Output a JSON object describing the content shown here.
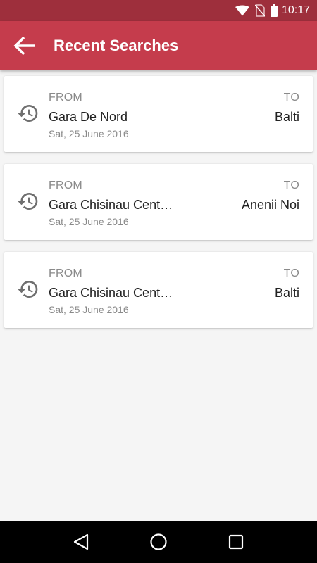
{
  "status_bar": {
    "time": "10:17",
    "icons": [
      "wifi-icon",
      "no-sim-icon",
      "battery-icon"
    ]
  },
  "app_bar": {
    "title": "Recent Searches",
    "back_icon": "arrow-left-icon"
  },
  "colors": {
    "status_bar": "#9e2f3c",
    "app_bar": "#c53c4c",
    "background": "#f5f5f5"
  },
  "searches": [
    {
      "from_label": "FROM",
      "from": "Gara De Nord",
      "to_label": "TO",
      "to": "Balti",
      "date": "Sat, 25 June 2016",
      "icon": "history-icon"
    },
    {
      "from_label": "FROM",
      "from": "Gara Chisinau Centrala",
      "to_label": "TO",
      "to": "Anenii Noi",
      "date": "Sat, 25 June 2016",
      "icon": "history-icon"
    },
    {
      "from_label": "FROM",
      "from": "Gara Chisinau Centrala",
      "to_label": "TO",
      "to": "Balti",
      "date": "Sat, 25 June 2016",
      "icon": "history-icon"
    }
  ],
  "nav_bar": {
    "buttons": [
      "back-triangle-icon",
      "home-circle-icon",
      "recents-square-icon"
    ]
  }
}
